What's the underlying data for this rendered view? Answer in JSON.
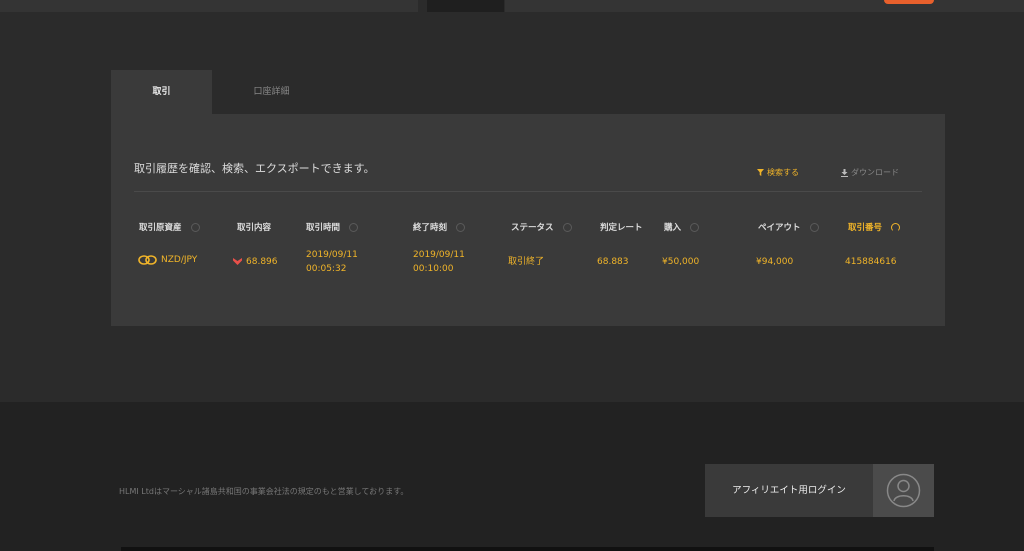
{
  "tabs": [
    {
      "label": "取引"
    },
    {
      "label": "口座詳細"
    }
  ],
  "panel": {
    "description": "取引履歴を確認、検索、エクスポートできます。",
    "filter_label": "検索する",
    "download_label": "ダウンロード"
  },
  "table": {
    "headers": [
      "取引原資産",
      "取引内容",
      "取引時間",
      "終了時刻",
      "ステータス",
      "判定レート",
      "購入",
      "ペイアウト",
      "取引番号"
    ],
    "rows": [
      {
        "asset": "NZD/JPY",
        "direction_icon": "down-arrow-icon",
        "rate": "68.896",
        "start_date": "2019/09/11",
        "start_time": "00:05:32",
        "end_date": "2019/09/11",
        "end_time": "00:10:00",
        "status": "取引終了",
        "judged_rate": "68.883",
        "purchase": "¥50,000",
        "payout": "¥94,000",
        "trade_id": "415884616"
      }
    ]
  },
  "footer": {
    "company_text": "HLMI Ltdはマーシャル諸島共和国の事業会社法の規定のもと営業しております。",
    "affiliate_login": "アフィリエイト用ログイン"
  },
  "colors": {
    "accent": "#f0b429",
    "orange": "#e8602c",
    "down": "#e8504a"
  }
}
